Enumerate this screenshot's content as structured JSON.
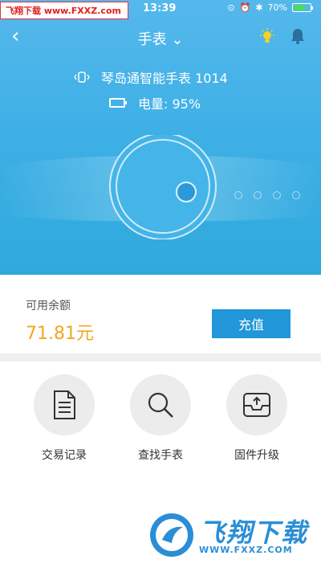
{
  "status_bar": {
    "watermark": "飞翔下载 www.FXXZ.com",
    "time": "13:39",
    "battery_percent": "70%",
    "battery_level": 0.7
  },
  "nav": {
    "title": "手表 ⌄",
    "back_icon": "chevron-left-icon",
    "light_icon": "lightbulb-icon",
    "bell_icon": "bell-icon"
  },
  "device": {
    "name": "琴岛通智能手表 1014",
    "battery_label": "电量: 95%"
  },
  "balance": {
    "label": "可用余额",
    "amount": "71.81元",
    "recharge_button": "充值"
  },
  "actions": [
    {
      "label": "交易记录",
      "icon": "document-icon"
    },
    {
      "label": "查找手表",
      "icon": "search-icon"
    },
    {
      "label": "固件升级",
      "icon": "upgrade-box-icon"
    }
  ],
  "watermark_bottom": {
    "text": "飞翔下载",
    "url": "WWW.FXXZ.COM"
  },
  "colors": {
    "hero_blue": "#3fb0e6",
    "accent_blue": "#2196d8",
    "amount_orange": "#f0a820",
    "bulb_yellow": "#f7d21e"
  }
}
